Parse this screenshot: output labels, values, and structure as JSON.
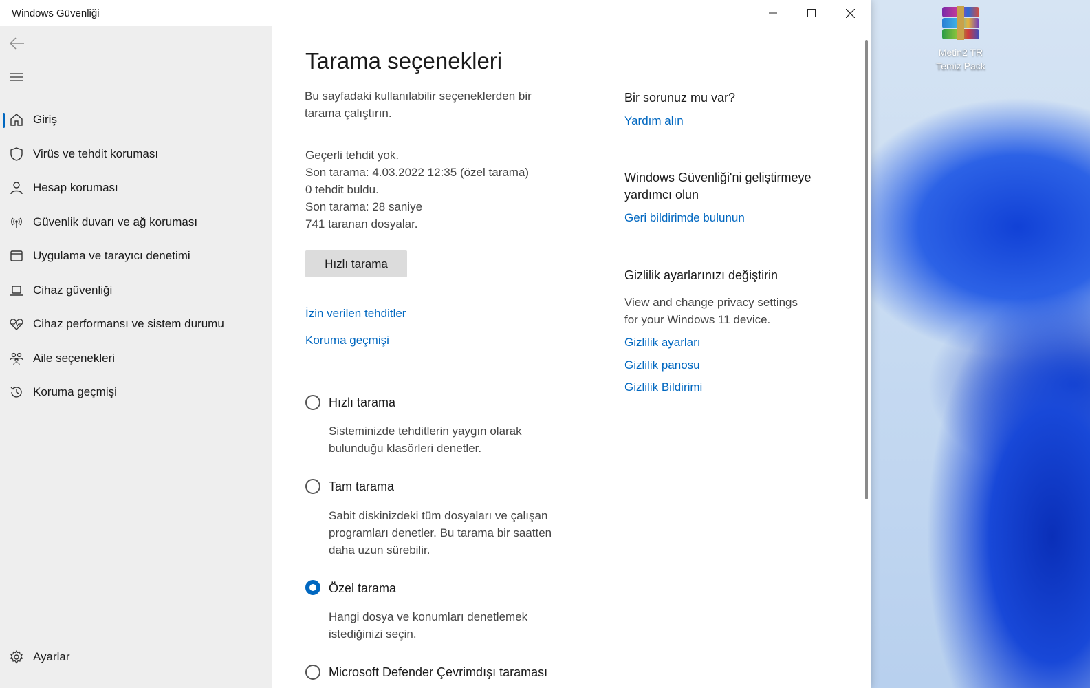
{
  "desktop": {
    "icon_label_line1": "Metin2 TR",
    "icon_label_line2": "Temiz Pack"
  },
  "window": {
    "title": "Windows Güvenliği"
  },
  "sidebar": {
    "items": [
      {
        "label": "Giriş",
        "icon": "home-icon"
      },
      {
        "label": "Virüs ve tehdit koruması",
        "icon": "shield-icon"
      },
      {
        "label": "Hesap koruması",
        "icon": "person-icon"
      },
      {
        "label": "Güvenlik duvarı ve ağ koruması",
        "icon": "wifi-antenna-icon"
      },
      {
        "label": "Uygulama ve tarayıcı denetimi",
        "icon": "app-window-icon"
      },
      {
        "label": "Cihaz güvenliği",
        "icon": "laptop-icon"
      },
      {
        "label": "Cihaz performansı ve sistem durumu",
        "icon": "heart-pulse-icon"
      },
      {
        "label": "Aile seçenekleri",
        "icon": "family-icon"
      },
      {
        "label": "Koruma geçmişi",
        "icon": "history-icon"
      }
    ],
    "settings_label": "Ayarlar"
  },
  "main": {
    "title": "Tarama seçenekleri",
    "intro_line1": "Bu sayfadaki kullanılabilir seçeneklerden bir",
    "intro_line2": "tarama çalıştırın.",
    "status": [
      "Geçerli tehdit yok.",
      "Son tarama: 4.03.2022 12:35 (özel tarama)",
      "0 tehdit buldu.",
      "Son tarama: 28 saniye",
      "741 taranan dosyalar."
    ],
    "quick_scan_button": "Hızlı tarama",
    "allowed_threats_link": "İzin verilen tehditler",
    "protection_history_link": "Koruma geçmişi",
    "options": [
      {
        "label": "Hızlı tarama",
        "desc": [
          "Sisteminizde tehditlerin yaygın olarak",
          "bulunduğu klasörleri denetler."
        ],
        "checked": false
      },
      {
        "label": "Tam tarama",
        "desc": [
          "Sabit diskinizdeki tüm dosyaları ve çalışan",
          "programları denetler. Bu tarama bir saatten",
          "daha uzun sürebilir."
        ],
        "checked": false
      },
      {
        "label": "Özel tarama",
        "desc": [
          "Hangi dosya ve konumları denetlemek",
          "istediğinizi seçin."
        ],
        "checked": true
      },
      {
        "label": "Microsoft Defender Çevrimdışı taraması",
        "desc": [],
        "checked": false
      }
    ]
  },
  "aside": {
    "question_heading": "Bir sorunuz mu var?",
    "help_link": "Yardım alın",
    "improve_heading_line1": "Windows Güvenliği'ni geliştirmeye",
    "improve_heading_line2": "yardımcı olun",
    "feedback_link": "Geri bildirimde bulunun",
    "privacy_heading": "Gizlilik ayarlarınızı değiştirin",
    "privacy_desc_line1": "View and change privacy settings",
    "privacy_desc_line2": "for your Windows 11 device.",
    "privacy_settings_link": "Gizlilik ayarları",
    "privacy_dashboard_link": "Gizlilik panosu",
    "privacy_statement_link": "Gizlilik Bildirimi"
  },
  "colors": {
    "accent": "#0067c0",
    "sidebar_bg": "#eeeeee"
  }
}
